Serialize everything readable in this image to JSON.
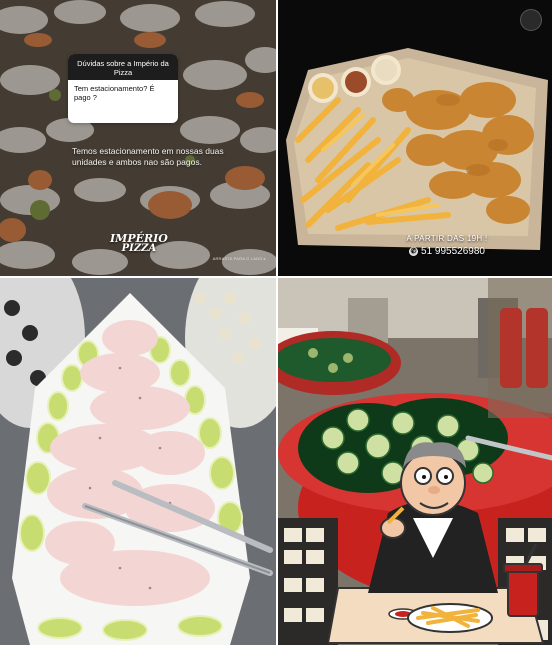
{
  "story_card": {
    "header": "Dúvidas sobre a Império da Pizza",
    "question": "Tem estacionamento? É pago ?"
  },
  "story_answer": "Temos estacionamento em nossas duas unidades e ambos nao são pagos.",
  "brand": {
    "line1": "IMPÉRIO",
    "line2": "PIZZA"
  },
  "swipe_hint": "ARRASTA PARA O LADO ▸",
  "promo": {
    "time": "A PARTIR DAS 19H !",
    "phone": "51 995526980"
  },
  "colors": {
    "tray_red": "#c8221e",
    "promo_bg": "#0a0a0a",
    "fries": "#f2b33d"
  },
  "icons": [
    "whatsapp-icon",
    "logo-badge",
    "cartoon-man-eating-fries"
  ]
}
